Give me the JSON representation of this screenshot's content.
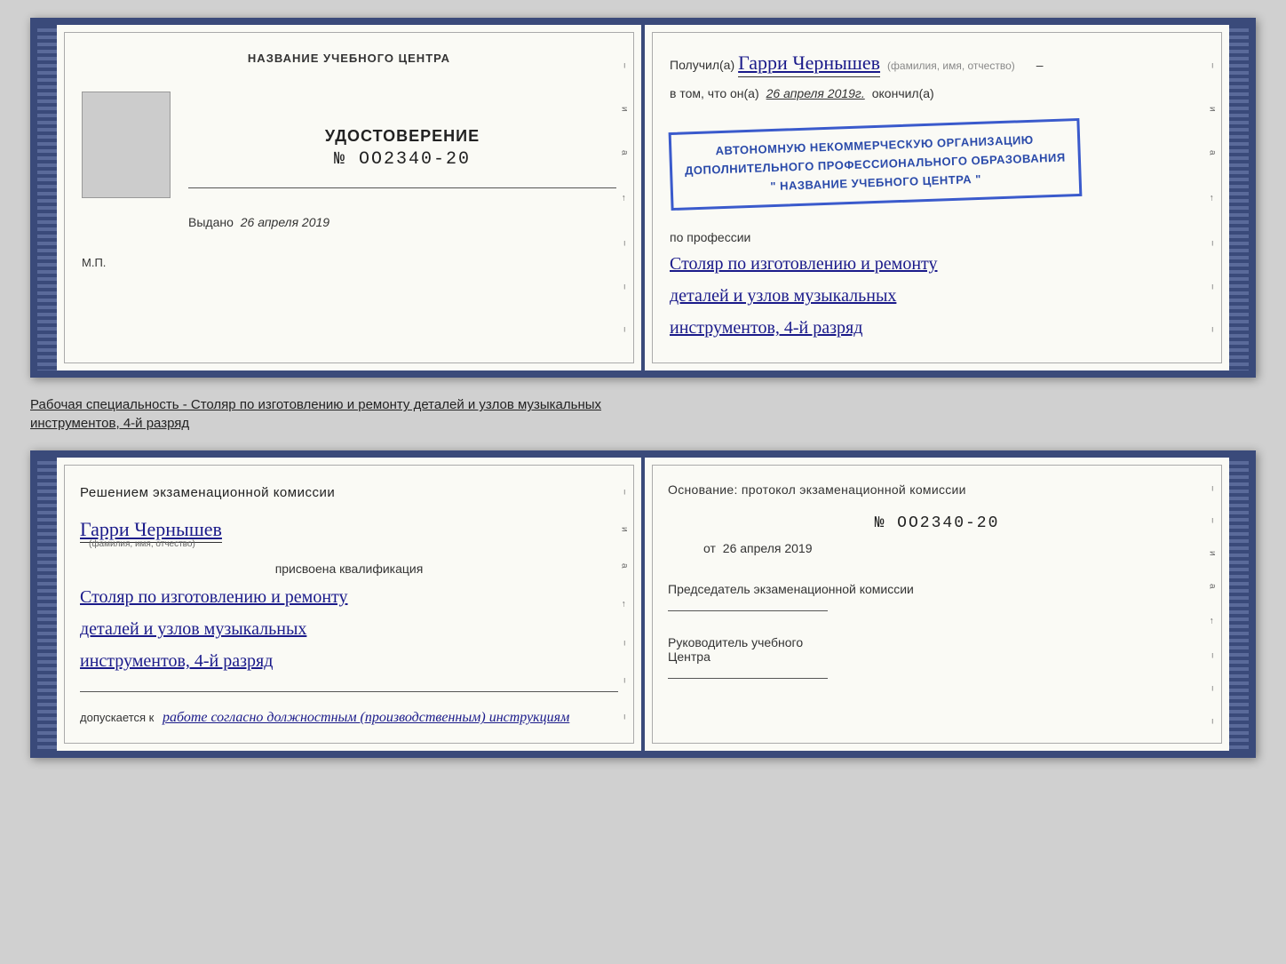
{
  "page": {
    "background_color": "#d0d0d0"
  },
  "top_spread": {
    "left_page": {
      "header": "НАЗВАНИЕ УЧЕБНОГО ЦЕНТРА",
      "cert_title": "УДОСТОВЕРЕНИЕ",
      "cert_number": "№ OO2340-20",
      "issued_label": "Выдано",
      "issued_date": "26 апреля 2019",
      "mp_label": "М.П."
    },
    "right_page": {
      "received_label": "Получил(а)",
      "name": "Гарри Чернышев",
      "fio_hint": "(фамилия, имя, отчество)",
      "in_that_label": "в том, что он(а)",
      "completed_date": "26 апреля 2019г.",
      "finished_label": "окончил(а)",
      "org_line1": "АВТОНОМНУЮ НЕКОММЕРЧЕСКУЮ ОРГАНИЗАЦИЮ",
      "org_line2": "ДОПОЛНИТЕЛЬНОГО ПРОФЕССИОНАЛЬНОГО ОБРАЗОВАНИЯ",
      "org_line3": "\" НАЗВАНИЕ УЧЕБНОГО ЦЕНТРА \"",
      "profession_label": "по профессии",
      "profession_line1": "Столяр по изготовлению и ремонту",
      "profession_line2": "деталей и узлов музыкальных",
      "profession_line3": "инструментов, 4-й разряд"
    }
  },
  "description": {
    "text": "Рабочая специальность - Столяр по изготовлению и ремонту деталей и узлов музыкальных",
    "text2": "инструментов, 4-й разряд"
  },
  "bottom_spread": {
    "left_page": {
      "decision_text": "Решением экзаменационной комиссии",
      "name": "Гарри Чернышев",
      "fio_hint": "(фамилия, имя, отчество)",
      "qualification_label": "присвоена квалификация",
      "qualification_line1": "Столяр по изготовлению и ремонту",
      "qualification_line2": "деталей и узлов музыкальных",
      "qualification_line3": "инструментов, 4-й разряд",
      "allowed_prefix": "допускается к",
      "allowed_text": "работе согласно должностным (производственным) инструкциям"
    },
    "right_page": {
      "basis_label": "Основание: протокол экзаменационной комиссии",
      "protocol_number": "№ OO2340-20",
      "date_prefix": "от",
      "date": "26 апреля 2019",
      "chairman_label": "Председатель экзаменационной комиссии",
      "director_label": "Руководитель учебного",
      "director_label2": "Центра"
    }
  }
}
